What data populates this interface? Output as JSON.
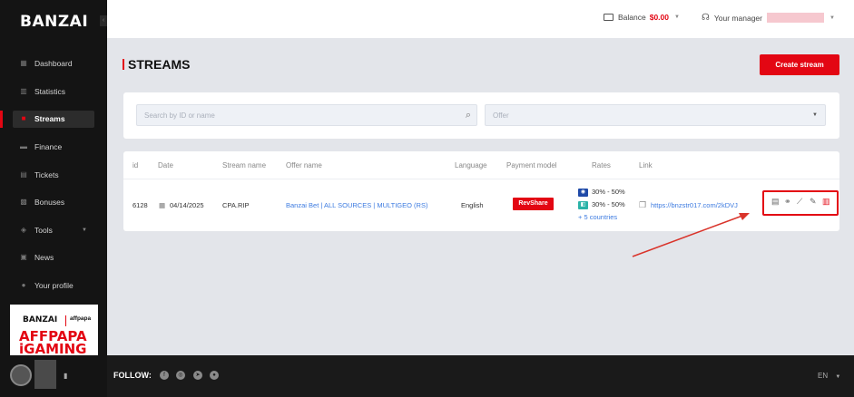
{
  "brand": {
    "logo": "BANZAI",
    "collapse_glyph": "‹"
  },
  "sidebar": {
    "items": [
      {
        "label": "Dashboard",
        "icon": "dashboard-icon"
      },
      {
        "label": "Statistics",
        "icon": "statistics-icon"
      },
      {
        "label": "Streams",
        "icon": "streams-icon"
      },
      {
        "label": "Finance",
        "icon": "finance-icon"
      },
      {
        "label": "Tickets",
        "icon": "tickets-icon"
      },
      {
        "label": "Bonuses",
        "icon": "bonuses-icon"
      },
      {
        "label": "Tools",
        "icon": "tools-icon"
      },
      {
        "label": "News",
        "icon": "news-icon"
      },
      {
        "label": "Your profile",
        "icon": "profile-icon"
      }
    ],
    "promo": {
      "brand": "BANZAI",
      "partner": "affpapa",
      "headline": "AFFPAPA iGAMING"
    }
  },
  "topbar": {
    "balance_label": "Balance",
    "balance_amount": "$0.00",
    "manager_label": "Your manager"
  },
  "page": {
    "title": "STREAMS",
    "create_button": "Create stream"
  },
  "filters": {
    "search_placeholder": "Search by ID or name",
    "offer_placeholder": "Offer"
  },
  "table": {
    "headers": [
      "id",
      "Date",
      "Stream name",
      "Offer name",
      "Language",
      "Payment model",
      "Rates",
      "Link"
    ],
    "row": {
      "id": "6128",
      "date": "04/14/2025",
      "stream_name": "CPA.RIP",
      "offer_name": "Banzai Bet | ALL SOURCES | MULTIGEO (RS)",
      "language": "English",
      "payment_model": "RevShare",
      "rate1": "30% - 50%",
      "rate2": "30% - 50%",
      "more_countries": "+ 5 countries",
      "link": "https://bnzstr017.com/2kDVJ"
    }
  },
  "footer": {
    "follow_label": "FOLLOW:",
    "language": "EN"
  },
  "colors": {
    "accent": "#e30613",
    "link": "#3d7be0",
    "sidebar_bg": "#141414"
  }
}
